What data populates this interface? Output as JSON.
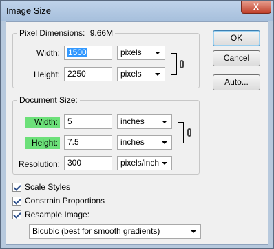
{
  "window": {
    "title": "Image Size",
    "close_glyph": "X"
  },
  "pixel_dimensions": {
    "legend": "Pixel Dimensions:",
    "size_value": "9.66M",
    "width_label": "Width:",
    "width_value": "1500",
    "width_unit": "pixels",
    "height_label": "Height:",
    "height_value": "2250",
    "height_unit": "pixels"
  },
  "document_size": {
    "legend": "Document Size:",
    "width_label": "Width:",
    "width_value": "5",
    "width_unit": "inches",
    "height_label": "Height:",
    "height_value": "7.5",
    "height_unit": "inches",
    "resolution_label": "Resolution:",
    "resolution_value": "300",
    "resolution_unit": "pixels/inch"
  },
  "buttons": {
    "ok": "OK",
    "cancel": "Cancel",
    "auto": "Auto..."
  },
  "options": {
    "scale_styles": {
      "label": "Scale Styles",
      "checked": true
    },
    "constrain_proportions": {
      "label": "Constrain Proportions",
      "checked": true
    },
    "resample_image": {
      "label": "Resample Image:",
      "checked": true
    }
  },
  "resample_method": "Bicubic (best for smooth gradients)",
  "colors": {
    "highlight": "#6ce079",
    "selection": "#3399ff",
    "title_close": "#c0402a"
  }
}
